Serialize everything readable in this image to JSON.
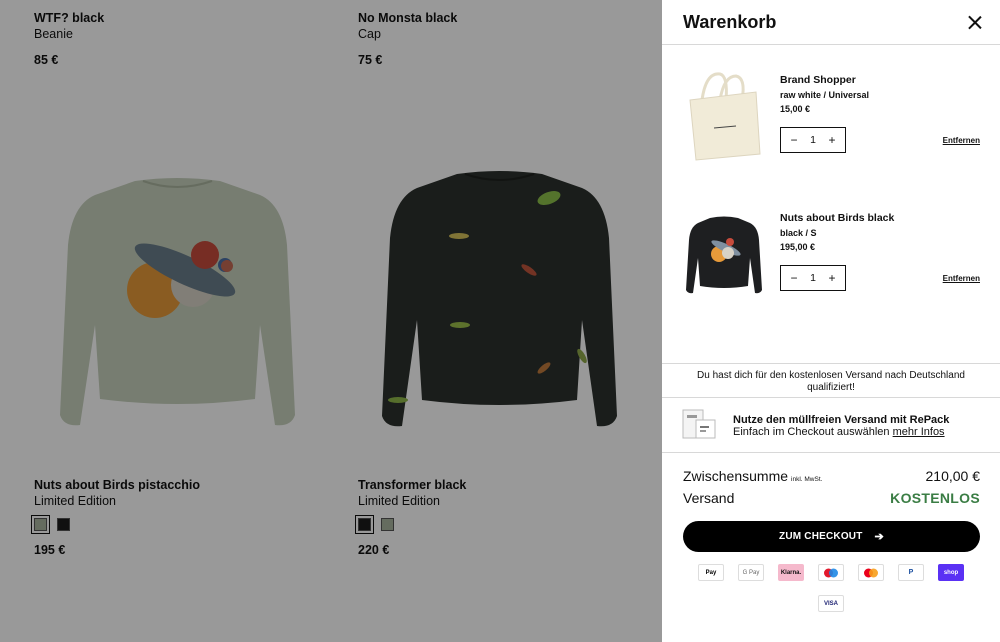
{
  "products": [
    {
      "name": "WTF? black",
      "sub": "Beanie",
      "price": "85 €"
    },
    {
      "name": "No Monsta black",
      "sub": "Cap",
      "price": "75 €"
    },
    {
      "name": "Nuts about Birds pistacchio",
      "sub": "Limited Edition",
      "price": "195 €",
      "swatches": [
        "#a9b49f",
        "#1c1c1c"
      ]
    },
    {
      "name": "Transformer black",
      "sub": "Limited Edition",
      "price": "220 €",
      "swatches": [
        "#1c1c1c",
        "#a9b49f"
      ]
    }
  ],
  "cart": {
    "title": "Warenkorb",
    "items": [
      {
        "name": "Brand Shopper",
        "variant": "raw white / Universal",
        "price": "15,00 €",
        "qty": "1",
        "remove": "Entfernen"
      },
      {
        "name": "Nuts about Birds black",
        "variant": "black / S",
        "price": "195,00 €",
        "qty": "1",
        "remove": "Entfernen"
      }
    ],
    "shipping_note": "Du hast dich für den kostenlosen Versand nach Deutschland qualifiziert!",
    "repack": {
      "title": "Nutze den müllfreien Versand mit RePack",
      "sub": "Einfach im Checkout auswählen",
      "link": "mehr Infos"
    },
    "subtotal_label": "Zwischensumme",
    "subtotal_note": "inkl. MwSt.",
    "subtotal_value": "210,00 €",
    "shipping_label": "Versand",
    "shipping_value": "KOSTENLOS",
    "checkout_label": "ZUM CHECKOUT",
    "checkout_arrow": "➔",
    "payment_methods": [
      "Pay",
      "G Pay",
      "Klarna.",
      "maestro",
      "mastercard",
      "P",
      "shop",
      "VISA"
    ]
  },
  "colors": {
    "free_green": "#3a7d44",
    "overlay": "rgba(0,0,0,0.40)"
  }
}
